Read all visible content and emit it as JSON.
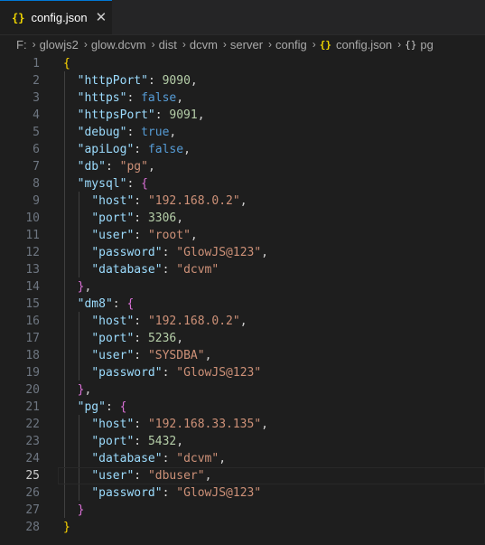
{
  "tab": {
    "icon": "json-braces-icon",
    "icon_glyph": "{}",
    "label": "config.json",
    "close_glyph": "✕"
  },
  "breadcrumb": {
    "items": [
      "F:",
      "glowjs2",
      "glow.dcvm",
      "dist",
      "dcvm",
      "server",
      "config"
    ],
    "file_glyph": "{}",
    "file": "config.json",
    "symbol_glyph": "{}",
    "symbol": "pg",
    "separator": "›"
  },
  "editor": {
    "active_line": 25,
    "lines": [
      {
        "n": "1",
        "tokens": [
          [
            "br1",
            "{"
          ]
        ]
      },
      {
        "n": "2",
        "tokens": [
          [
            "p",
            "  "
          ],
          [
            "k",
            "\"httpPort\""
          ],
          [
            "p",
            ": "
          ],
          [
            "n",
            "9090"
          ],
          [
            "p",
            ","
          ]
        ]
      },
      {
        "n": "3",
        "tokens": [
          [
            "p",
            "  "
          ],
          [
            "k",
            "\"https\""
          ],
          [
            "p",
            ": "
          ],
          [
            "b",
            "false"
          ],
          [
            "p",
            ","
          ]
        ]
      },
      {
        "n": "4",
        "tokens": [
          [
            "p",
            "  "
          ],
          [
            "k",
            "\"httpsPort\""
          ],
          [
            "p",
            ": "
          ],
          [
            "n",
            "9091"
          ],
          [
            "p",
            ","
          ]
        ]
      },
      {
        "n": "5",
        "tokens": [
          [
            "p",
            "  "
          ],
          [
            "k",
            "\"debug\""
          ],
          [
            "p",
            ": "
          ],
          [
            "b",
            "true"
          ],
          [
            "p",
            ","
          ]
        ]
      },
      {
        "n": "6",
        "tokens": [
          [
            "p",
            "  "
          ],
          [
            "k",
            "\"apiLog\""
          ],
          [
            "p",
            ": "
          ],
          [
            "b",
            "false"
          ],
          [
            "p",
            ","
          ]
        ]
      },
      {
        "n": "7",
        "tokens": [
          [
            "p",
            "  "
          ],
          [
            "k",
            "\"db\""
          ],
          [
            "p",
            ": "
          ],
          [
            "s",
            "\"pg\""
          ],
          [
            "p",
            ","
          ]
        ]
      },
      {
        "n": "8",
        "tokens": [
          [
            "p",
            "  "
          ],
          [
            "k",
            "\"mysql\""
          ],
          [
            "p",
            ": "
          ],
          [
            "br2",
            "{"
          ]
        ]
      },
      {
        "n": "9",
        "tokens": [
          [
            "p",
            "    "
          ],
          [
            "k",
            "\"host\""
          ],
          [
            "p",
            ": "
          ],
          [
            "s",
            "\"192.168.0.2\""
          ],
          [
            "p",
            ","
          ]
        ]
      },
      {
        "n": "10",
        "tokens": [
          [
            "p",
            "    "
          ],
          [
            "k",
            "\"port\""
          ],
          [
            "p",
            ": "
          ],
          [
            "n",
            "3306"
          ],
          [
            "p",
            ","
          ]
        ]
      },
      {
        "n": "11",
        "tokens": [
          [
            "p",
            "    "
          ],
          [
            "k",
            "\"user\""
          ],
          [
            "p",
            ": "
          ],
          [
            "s",
            "\"root\""
          ],
          [
            "p",
            ","
          ]
        ]
      },
      {
        "n": "12",
        "tokens": [
          [
            "p",
            "    "
          ],
          [
            "k",
            "\"password\""
          ],
          [
            "p",
            ": "
          ],
          [
            "s",
            "\"GlowJS@123\""
          ],
          [
            "p",
            ","
          ]
        ]
      },
      {
        "n": "13",
        "tokens": [
          [
            "p",
            "    "
          ],
          [
            "k",
            "\"database\""
          ],
          [
            "p",
            ": "
          ],
          [
            "s",
            "\"dcvm\""
          ]
        ]
      },
      {
        "n": "14",
        "tokens": [
          [
            "p",
            "  "
          ],
          [
            "br2",
            "}"
          ],
          [
            "p",
            ","
          ]
        ]
      },
      {
        "n": "15",
        "tokens": [
          [
            "p",
            "  "
          ],
          [
            "k",
            "\"dm8\""
          ],
          [
            "p",
            ": "
          ],
          [
            "br2",
            "{"
          ]
        ]
      },
      {
        "n": "16",
        "tokens": [
          [
            "p",
            "    "
          ],
          [
            "k",
            "\"host\""
          ],
          [
            "p",
            ": "
          ],
          [
            "s",
            "\"192.168.0.2\""
          ],
          [
            "p",
            ","
          ]
        ]
      },
      {
        "n": "17",
        "tokens": [
          [
            "p",
            "    "
          ],
          [
            "k",
            "\"port\""
          ],
          [
            "p",
            ": "
          ],
          [
            "n",
            "5236"
          ],
          [
            "p",
            ","
          ]
        ]
      },
      {
        "n": "18",
        "tokens": [
          [
            "p",
            "    "
          ],
          [
            "k",
            "\"user\""
          ],
          [
            "p",
            ": "
          ],
          [
            "s",
            "\"SYSDBA\""
          ],
          [
            "p",
            ","
          ]
        ]
      },
      {
        "n": "19",
        "tokens": [
          [
            "p",
            "    "
          ],
          [
            "k",
            "\"password\""
          ],
          [
            "p",
            ": "
          ],
          [
            "s",
            "\"GlowJS@123\""
          ]
        ]
      },
      {
        "n": "20",
        "tokens": [
          [
            "p",
            "  "
          ],
          [
            "br2",
            "}"
          ],
          [
            "p",
            ","
          ]
        ]
      },
      {
        "n": "21",
        "tokens": [
          [
            "p",
            "  "
          ],
          [
            "k",
            "\"pg\""
          ],
          [
            "p",
            ": "
          ],
          [
            "br2",
            "{"
          ]
        ]
      },
      {
        "n": "22",
        "tokens": [
          [
            "p",
            "    "
          ],
          [
            "k",
            "\"host\""
          ],
          [
            "p",
            ": "
          ],
          [
            "s",
            "\"192.168.33.135\""
          ],
          [
            "p",
            ","
          ]
        ]
      },
      {
        "n": "23",
        "tokens": [
          [
            "p",
            "    "
          ],
          [
            "k",
            "\"port\""
          ],
          [
            "p",
            ": "
          ],
          [
            "n",
            "5432"
          ],
          [
            "p",
            ","
          ]
        ]
      },
      {
        "n": "24",
        "tokens": [
          [
            "p",
            "    "
          ],
          [
            "k",
            "\"database\""
          ],
          [
            "p",
            ": "
          ],
          [
            "s",
            "\"dcvm\""
          ],
          [
            "p",
            ","
          ]
        ]
      },
      {
        "n": "25",
        "tokens": [
          [
            "p",
            "    "
          ],
          [
            "k",
            "\"user\""
          ],
          [
            "p",
            ": "
          ],
          [
            "s",
            "\"dbuser\""
          ],
          [
            "p",
            ","
          ]
        ]
      },
      {
        "n": "26",
        "tokens": [
          [
            "p",
            "    "
          ],
          [
            "k",
            "\"password\""
          ],
          [
            "p",
            ": "
          ],
          [
            "s",
            "\"GlowJS@123\""
          ]
        ]
      },
      {
        "n": "27",
        "tokens": [
          [
            "p",
            "  "
          ],
          [
            "br2",
            "}"
          ]
        ]
      },
      {
        "n": "28",
        "tokens": [
          [
            "br1",
            "}"
          ]
        ]
      }
    ]
  }
}
